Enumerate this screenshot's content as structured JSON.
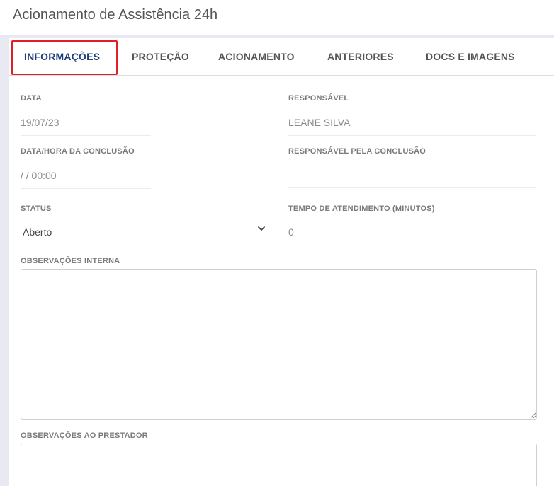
{
  "page": {
    "title": "Acionamento de Assistência 24h"
  },
  "tabs": [
    {
      "label": "INFORMAÇÕES",
      "active": true
    },
    {
      "label": "PROTEÇÃO",
      "active": false
    },
    {
      "label": "ACIONAMENTO",
      "active": false
    },
    {
      "label": "ANTERIORES",
      "active": false
    },
    {
      "label": "DOCS E IMAGENS",
      "active": false
    }
  ],
  "form": {
    "data": {
      "label": "DATA",
      "value": "19/07/23"
    },
    "responsavel": {
      "label": "RESPONSÁVEL",
      "value": "LEANE SILVA"
    },
    "conclusao": {
      "label": "DATA/HORA DA CONCLUSÃO",
      "value": "/ / 00:00"
    },
    "responsavel_conclusao": {
      "label": "RESPONSÁVEL PELA CONCLUSÃO",
      "value": ""
    },
    "status": {
      "label": "STATUS",
      "value": "Aberto"
    },
    "tempo_atendimento": {
      "label": "TEMPO DE ATENDIMENTO (MINUTOS)",
      "value": "0"
    },
    "observacoes_interna": {
      "label": "OBSERVAÇÕES INTERNA",
      "value": ""
    },
    "observacoes_prestador": {
      "label": "OBSERVAÇÕES AO PRESTADOR",
      "value": ""
    }
  },
  "colors": {
    "active_tab": "#1e3f7a",
    "highlight": "#e01f26",
    "band": "#e8e9f2"
  },
  "icons": {
    "status_select": "chevron-down-icon",
    "textarea_resize": "resize-grip-icon"
  }
}
